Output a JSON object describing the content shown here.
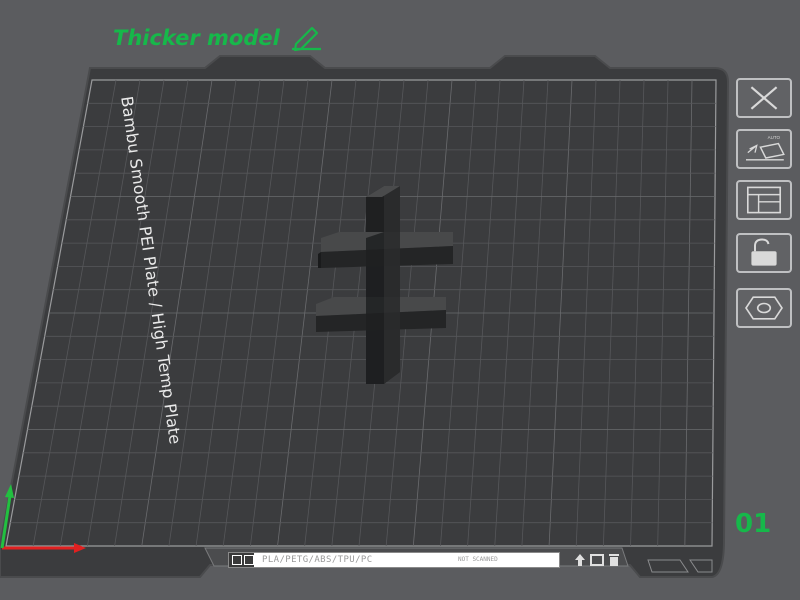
{
  "plate": {
    "name": "Bambu Smooth PEI Plate / High Temp Plate",
    "title": "Thicker model",
    "number": "01"
  },
  "toolbar": {
    "items": [
      {
        "id": "close",
        "icon": "close-icon"
      },
      {
        "id": "auto",
        "icon": "auto-orient-icon",
        "label": "AUTO"
      },
      {
        "id": "arrange",
        "icon": "arrange-icon"
      },
      {
        "id": "lock",
        "icon": "unlock-icon"
      },
      {
        "id": "settings",
        "icon": "hex-gear-icon"
      }
    ]
  },
  "status": {
    "filament_types": "PLA/PETG/ABS/TPU/PC",
    "scan_status": "NOT SCANNED"
  },
  "colors": {
    "accent_green": "#16b84a",
    "background": "#5b5c5f",
    "plate": "#3b3c3e",
    "axis_x": "#e02020",
    "axis_y": "#22c040"
  }
}
